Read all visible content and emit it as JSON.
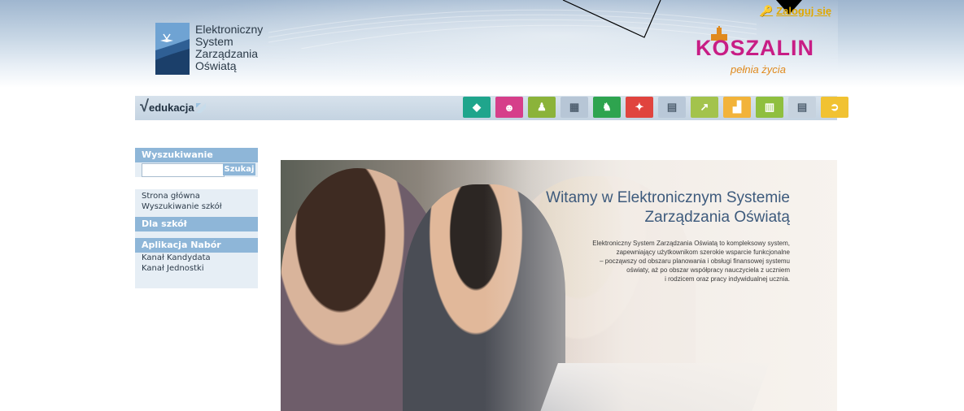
{
  "header": {
    "logo_lines": [
      "Elektroniczny",
      "System",
      "Zarządzania",
      "Oświatą"
    ],
    "login_label": "Zaloguj się",
    "city_name": "KOSZALIN",
    "city_tagline": "pełnia życia"
  },
  "toolbar": {
    "brand": "edukacja",
    "modules": [
      {
        "icon": "tag-icon",
        "color": "#1fa58c"
      },
      {
        "icon": "masks-icon",
        "color": "#d63e8a"
      },
      {
        "icon": "people-icon",
        "color": "#8bb33a"
      },
      {
        "icon": "grid-icon",
        "color": "#b7c6d6"
      },
      {
        "icon": "group-icon",
        "color": "#2ea44f"
      },
      {
        "icon": "share-icon",
        "color": "#e0443e"
      },
      {
        "icon": "abacus-icon",
        "color": "#b9c8d8"
      },
      {
        "icon": "chart-line-icon",
        "color": "#a3c34c"
      },
      {
        "icon": "chart-bar-icon",
        "color": "#f2b33a"
      },
      {
        "icon": "building-icon",
        "color": "#8fbf3f"
      },
      {
        "icon": "document-icon",
        "color": "#c6d2de"
      },
      {
        "icon": "exit-icon",
        "color": "#f1c232"
      }
    ]
  },
  "sidebar": {
    "search_title": "Wyszukiwanie",
    "search_value": "",
    "search_button": "Szukaj",
    "links_main": [
      "Strona główna",
      "Wyszukiwanie szkół"
    ],
    "section_schools": "Dla szkół",
    "section_nabor": "Aplikacja Nabór",
    "links_nabor": [
      "Kanał Kandydata",
      "Kanał Jednostki"
    ]
  },
  "hero": {
    "title_line1": "Witamy w Elektronicznym Systemie",
    "title_line2": "Zarządzania Oświatą",
    "text": [
      "Elektroniczny System Zarządzania Oświatą to kompleksowy system,",
      "zapewniający użytkownikom szerokie wsparcie funkcjonalne",
      "– począwszy od obszaru planowania i obsługi finansowej systemu",
      "oświaty, aż po obszar współpracy nauczyciela z uczniem",
      "i rodzicem oraz pracy indywidualnej ucznia."
    ]
  }
}
